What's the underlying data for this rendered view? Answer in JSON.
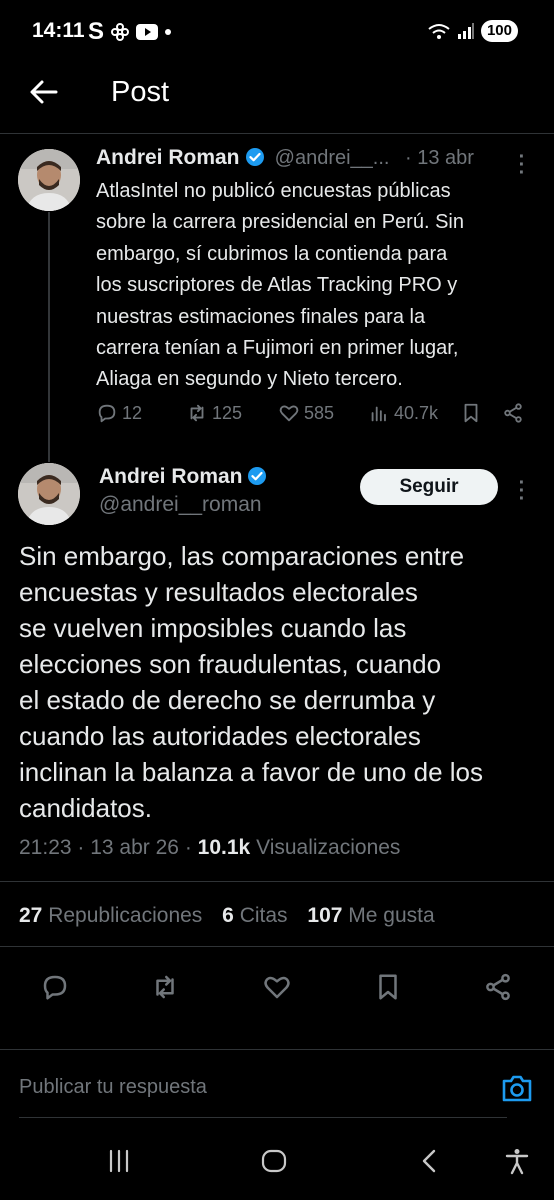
{
  "status_bar": {
    "time": "14:11",
    "battery": "100",
    "left_icons": [
      "s-app-icon",
      "flower-icon",
      "youtube-icon",
      "dot-icon"
    ],
    "right_icons": [
      "wifi-icon",
      "signal-icon"
    ],
    "wifi_label": "5"
  },
  "header": {
    "title": "Post"
  },
  "tweet1": {
    "name": "Andrei Roman",
    "handle": "@andrei__...",
    "date": "· 13 abr",
    "lines": [
      "AtlasIntel no publicó encuestas públicas",
      "sobre la carrera presidencial en Perú. Sin",
      "embargo, sí cubrimos la contienda para",
      "los suscriptores de Atlas Tracking PRO y",
      "nuestras estimaciones finales para la",
      "carrera tenían a Fujimori en primer lugar,",
      "Aliaga en segundo y Nieto tercero."
    ],
    "replies": "12",
    "reposts": "125",
    "likes": "585",
    "views": "40.7k"
  },
  "tweet2": {
    "name": "Andrei Roman",
    "handle": "@andrei__roman",
    "follow_label": "Seguir",
    "lines": [
      "Sin embargo, las comparaciones entre",
      "encuestas y resultados electorales",
      "se vuelven imposibles cuando las",
      "elecciones son fraudulentas, cuando",
      "el estado de derecho se derrumba y",
      "cuando las autoridades electorales",
      "inclinan la balanza a favor de uno de los",
      "candidatos."
    ],
    "time": "21:23",
    "date": "13 abr 26",
    "views_count": "10.1k",
    "views_label": "Visualizaciones",
    "reposts_count": "27",
    "reposts_label": "Republicaciones",
    "quotes_count": "6",
    "quotes_label": "Citas",
    "likes_count": "107",
    "likes_label": "Me gusta"
  },
  "reply_bar": {
    "placeholder": "Publicar tu respuesta"
  },
  "colors": {
    "background": "#000000",
    "text": "#e7e9ea",
    "muted": "#71767b",
    "accent": "#1d9bf0",
    "divider": "#2f3336"
  }
}
